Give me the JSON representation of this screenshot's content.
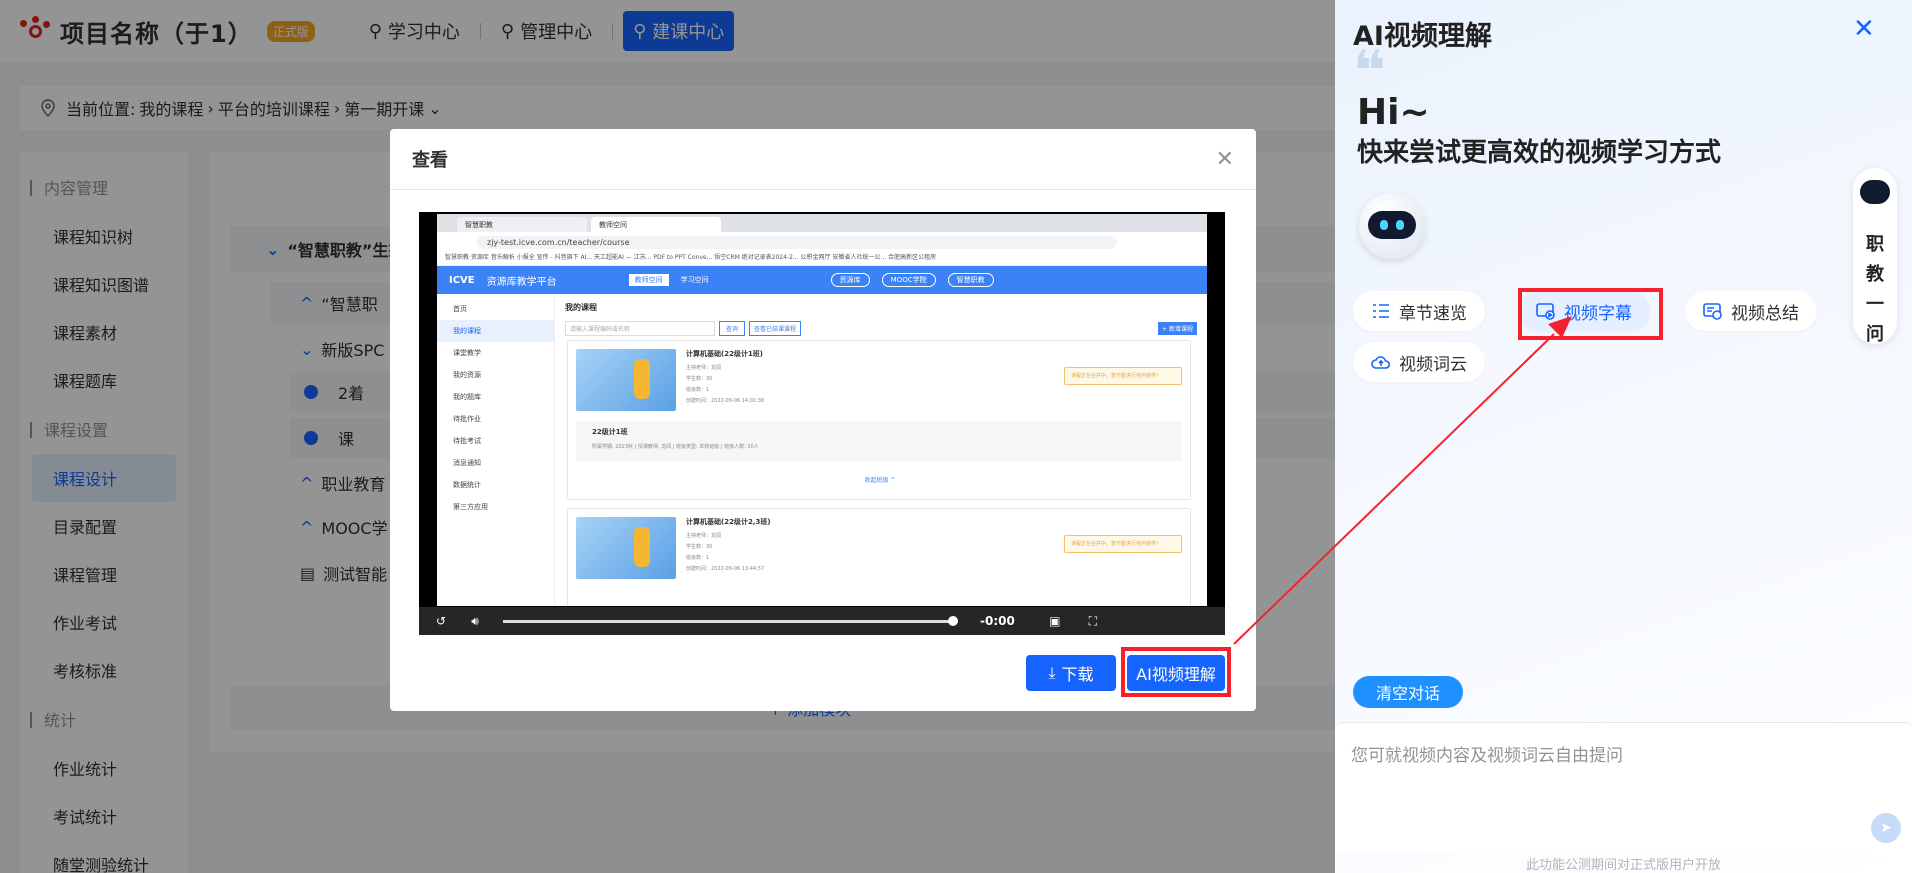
{
  "header": {
    "project_title": "项目名称（于1）",
    "edition_badge": "正式版",
    "nav": [
      {
        "label": "学习中心"
      },
      {
        "label": "管理中心"
      },
      {
        "label": "建课中心"
      }
    ]
  },
  "breadcrumb": {
    "prefix": "当前位置:",
    "items": [
      "我的课程",
      "平台的培训课程",
      "第一期开课"
    ]
  },
  "sidebar": {
    "groups": [
      {
        "label": "内容管理",
        "items": [
          "课程知识树",
          "课程知识图谱",
          "课程素材",
          "课程题库"
        ]
      },
      {
        "label": "课程设置",
        "items": [
          "课程设计",
          "目录配置",
          "课程管理",
          "作业考试",
          "考核标准"
        ]
      },
      {
        "label": "统计",
        "items": [
          "作业统计",
          "考试统计",
          "随堂测验统计"
        ]
      }
    ]
  },
  "content": {
    "rows": [
      "“智慧职教”生态",
      "“智慧职",
      "新版SPC",
      "2着",
      "课",
      "职业教育",
      "MOOC学",
      "测试智能"
    ],
    "add_chapter": "+ 添加模块"
  },
  "modal": {
    "title": "查看",
    "download_label": "下载",
    "ai_label": "AI视频理解",
    "video": {
      "time": "-0:00",
      "progress": 0.99,
      "browser": {
        "tabs": [
          "智慧职教",
          "教师空间"
        ],
        "url": "zjy-test.icve.com.cn/teacher/course",
        "bookmarks": "智慧职教·资源库  音乐解析  小报全  宣传 - 抖音旗下 AI...  天工超能AI — 江苏...  PDF to PPT Conve...  悟空CRM  绝对记录表2024-2...  公积金网厅  安徽省人社统一公...  合肥高新区公租房",
        "platform_title": "资源库教学平台",
        "header_tabs": [
          "教师空间",
          "学习空间"
        ],
        "header_pills": [
          "资源库",
          "MOOC学院",
          "智慧职教"
        ],
        "side_menu": [
          "首页",
          "我的课程",
          "课堂教学",
          "我的资源",
          "我的题库",
          "待批作业",
          "待批考试",
          "消息通知",
          "数据统计",
          "第三方应用"
        ],
        "section_title": "我的课程",
        "search_placeholder": "请输入课程编码或名称",
        "search_btn": "查询",
        "view_btn": "查看已结课课程",
        "new_btn": "+ 新增课程",
        "cards": [
          {
            "title": "计算机基础(22级计1班)",
            "meta": [
              "主持老师：龙闻",
              "学生数：30",
              "班级数：1",
              "创建时间：2022-09-06 14:01:38"
            ],
            "warn": "课程正在合并中，暂不能进行任何操作！"
          },
          {
            "title": "计算机基础(22级计2,3班)",
            "meta": [
              "主持老师：龙闻",
              "学生数：30",
              "班级数：1",
              "创建时间：2022-09-06 13:44:57"
            ],
            "warn": "课程正在合并中，暂不能进行任何操作！"
          }
        ],
        "class_row": "22级计1班",
        "class_meta": "所属学期: 2023秋   |   授课教师: 龙闻   |   班级类型: 本校班级   |   班级人数: 30人",
        "collapse": "收起班级 ^"
      }
    }
  },
  "ai_panel": {
    "title": "AI视频理解",
    "greeting": "Hi~",
    "slogan": "快来尝试更高效的视频学习方式",
    "chips": [
      "章节速览",
      "视频字幕",
      "视频总结",
      "视频词云"
    ],
    "float_label": [
      "职",
      "教",
      "一",
      "问"
    ],
    "clear_label": "清空对话",
    "input_placeholder": "您可就视频内容及视频词云自由提问",
    "footnote": "此功能公测期间对正式版用户开放"
  },
  "colors": {
    "primary": "#1664ff",
    "highlight": "#f5222d",
    "brand_red": "#e2231a"
  }
}
